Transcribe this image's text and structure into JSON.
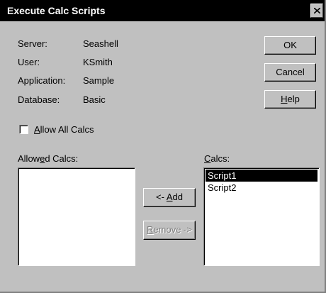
{
  "window": {
    "title": "Execute Calc Scripts"
  },
  "info": {
    "server_label": "Server:",
    "server_value": "Seashell",
    "user_label": "User:",
    "user_value": "KSmith",
    "application_label": "Application:",
    "application_value": "Sample",
    "database_label": "Database:",
    "database_value": "Basic"
  },
  "buttons": {
    "ok": "OK",
    "cancel": "Cancel",
    "help_mnemonic": "H",
    "help_rest": "elp",
    "add_prefix": "<- ",
    "add_mnemonic": "A",
    "add_rest": "dd",
    "remove_mnemonic": "R",
    "remove_rest": "emove ->"
  },
  "allow_all": {
    "mnemonic": "A",
    "rest": "llow All Calcs",
    "checked": false
  },
  "allowed_calcs": {
    "pre": "Allow",
    "mnemonic": "e",
    "post": "d Calcs:",
    "items": []
  },
  "calcs": {
    "mnemonic": "C",
    "rest": "alcs:",
    "items": [
      {
        "label": "Script1",
        "selected": true
      },
      {
        "label": "Script2",
        "selected": false
      }
    ]
  }
}
